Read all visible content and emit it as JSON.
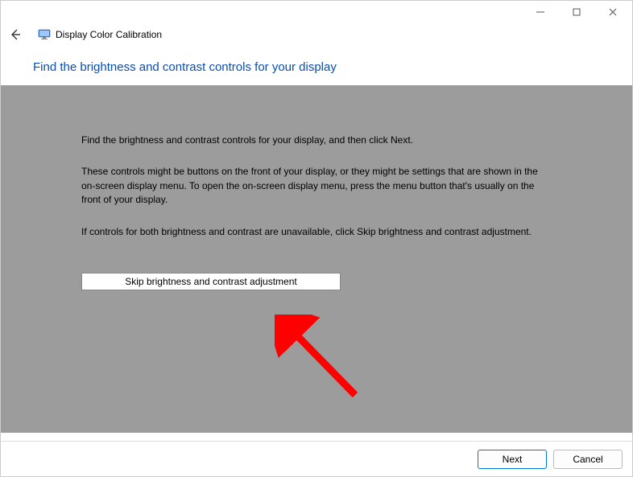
{
  "window": {
    "app_title": "Display Color Calibration",
    "heading": "Find the brightness and contrast controls for your display"
  },
  "content": {
    "p1": "Find the brightness and contrast controls for your display, and then click Next.",
    "p2": "These controls might be buttons on the front of your display, or they might be settings that are shown in the on-screen display menu. To open the on-screen display menu, press the menu button that's usually on the front of your display.",
    "p3": "If controls for both brightness and contrast are unavailable, click Skip brightness and contrast adjustment.",
    "skip_label": "Skip brightness and contrast adjustment"
  },
  "footer": {
    "next": "Next",
    "cancel": "Cancel"
  }
}
